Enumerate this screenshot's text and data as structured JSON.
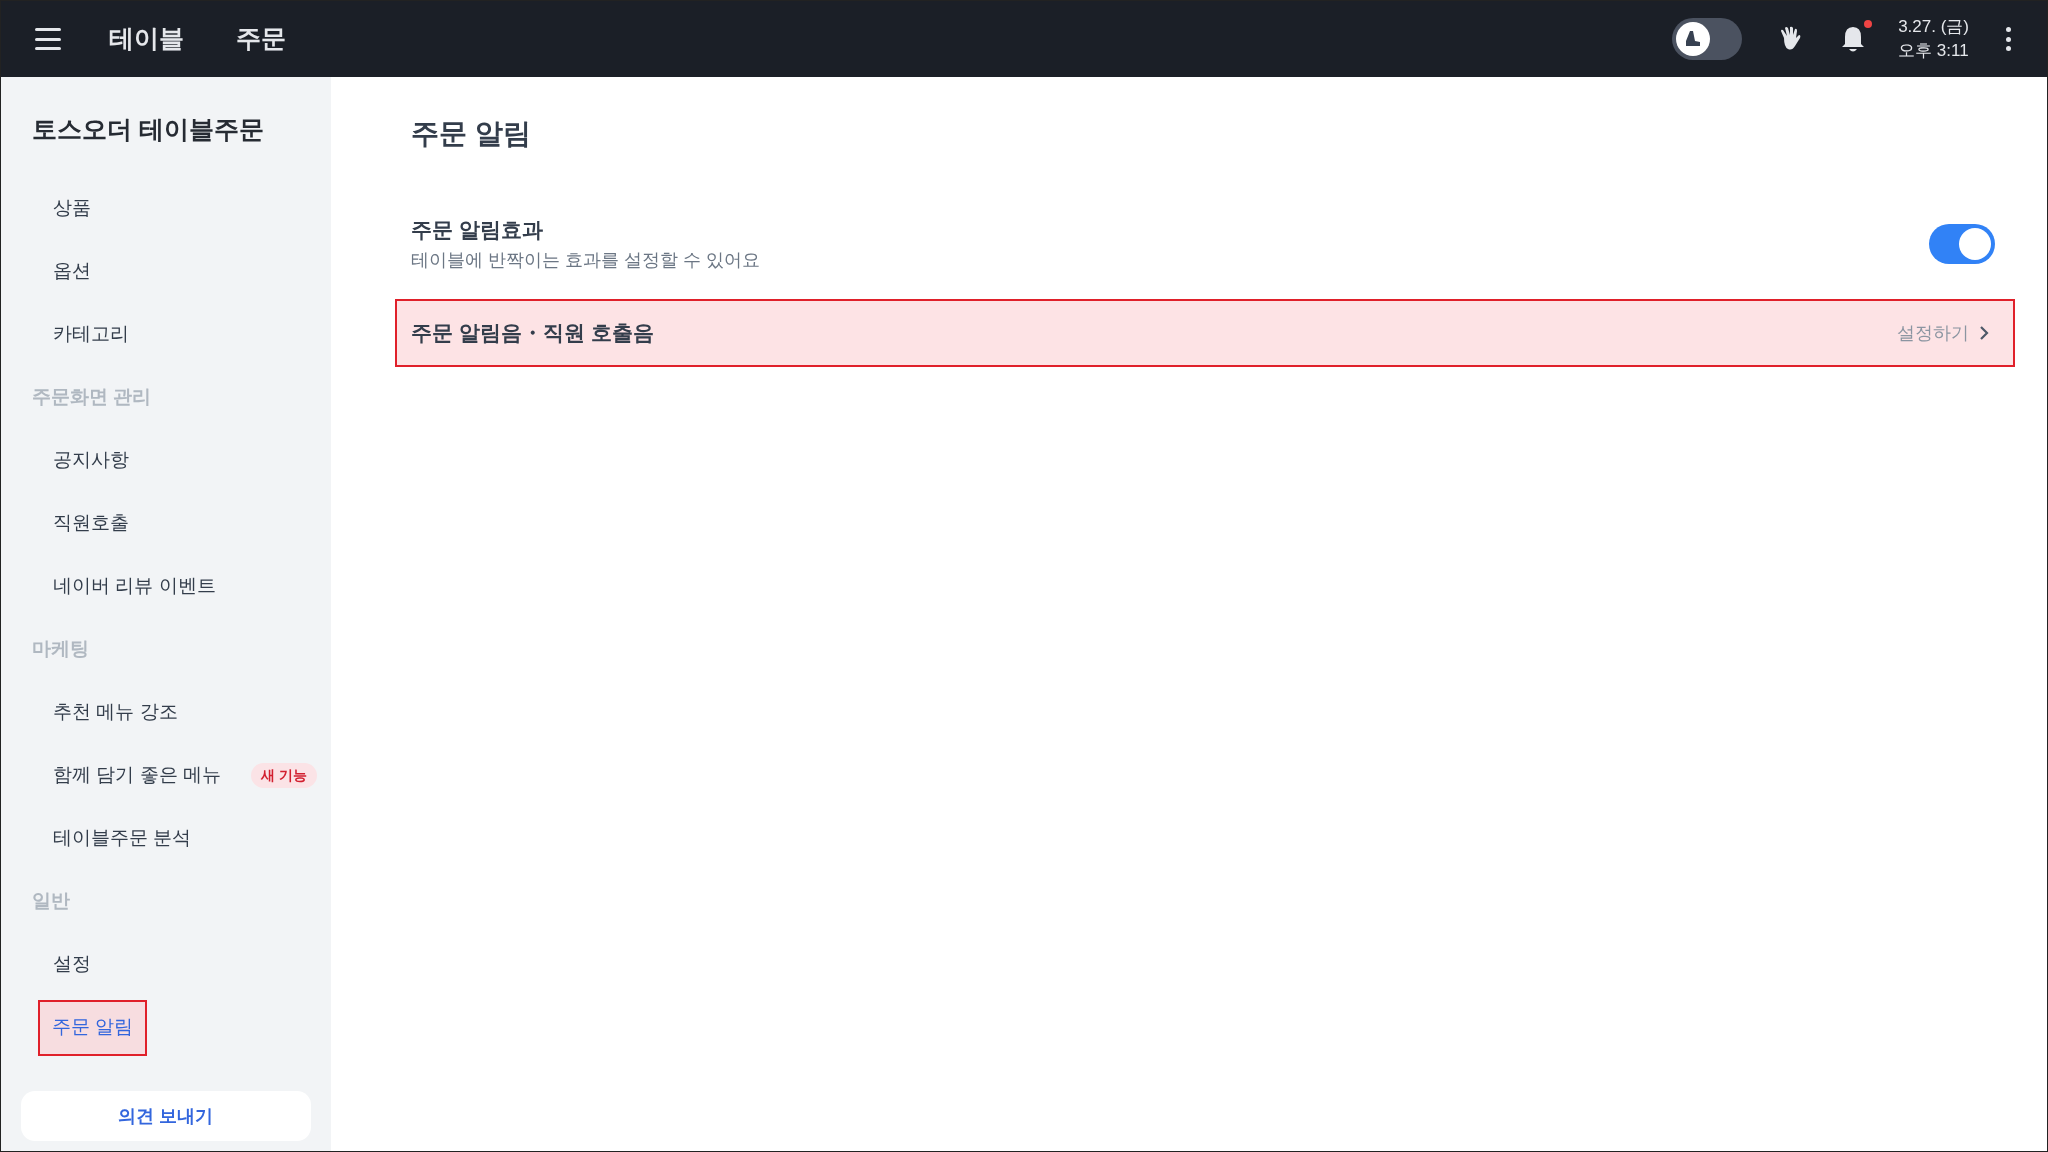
{
  "top_bar": {
    "tabs": [
      {
        "label": "테이블",
        "selected": false
      },
      {
        "label": "주문",
        "selected": false
      }
    ],
    "mode_toggle": {
      "on": false
    },
    "notification_dot": true,
    "date": "3.27. (금)",
    "time": "오후 3:11"
  },
  "sidebar": {
    "title": "토스오더 테이블주문",
    "items": [
      {
        "kind": "item",
        "label": "상품",
        "selected": false
      },
      {
        "kind": "item",
        "label": "옵션",
        "selected": false
      },
      {
        "kind": "item",
        "label": "카테고리",
        "selected": false
      },
      {
        "kind": "section",
        "label": "주문화면 관리"
      },
      {
        "kind": "item",
        "label": "공지사항",
        "selected": false
      },
      {
        "kind": "item",
        "label": "직원호출",
        "selected": false
      },
      {
        "kind": "item",
        "label": "네이버 리뷰 이벤트",
        "selected": false
      },
      {
        "kind": "section",
        "label": "마케팅"
      },
      {
        "kind": "item",
        "label": "추천 메뉴 강조",
        "selected": false
      },
      {
        "kind": "item",
        "label": "함께 담기 좋은 메뉴",
        "selected": false,
        "badge": "새 기능"
      },
      {
        "kind": "item",
        "label": "테이블주문 분석",
        "selected": false
      },
      {
        "kind": "section",
        "label": "일반"
      },
      {
        "kind": "item",
        "label": "설정",
        "selected": false
      },
      {
        "kind": "item",
        "label": "주문 알림",
        "selected": true,
        "highlighted": true
      }
    ],
    "feedback_button": "의견 보내기"
  },
  "main": {
    "title": "주문 알림",
    "settings": [
      {
        "kind": "toggle",
        "label": "주문 알림효과",
        "description": "테이블에 반짝이는 효과를 설정할 수 있어요",
        "on": true
      },
      {
        "kind": "link",
        "label": "주문 알림음・직원 호출음",
        "action": "설정하기",
        "highlighted": true
      }
    ]
  }
}
